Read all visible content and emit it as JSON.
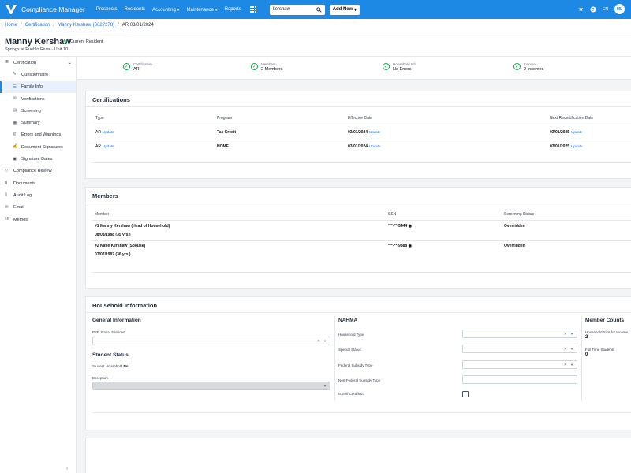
{
  "nav": {
    "brand": "Compliance Manager",
    "items": [
      "Prospects",
      "Residents",
      "Accounting",
      "Maintenance",
      "Reports"
    ],
    "search_value": "kershaw",
    "add_new": "Add New",
    "lang": "EN",
    "user_initials": "ML"
  },
  "breadcrumb": [
    "Home",
    "Certification",
    "Manny Kershaw (6027278)",
    "AR 03/01/2024"
  ],
  "header": {
    "name": "Manny Kershaw",
    "status": "Current Resident",
    "unit": "Springs at Pueblo River - Unit 101"
  },
  "sidebar": {
    "section": "Certification",
    "items": [
      "Questionnaire",
      "Family Info",
      "Verifications",
      "Screening",
      "Summary",
      "Errors and Warnings",
      "Document Signatures",
      "Signature Dates"
    ],
    "top_items": [
      "Compliance Review",
      "Documents",
      "Audit Log",
      "Email",
      "Memos"
    ]
  },
  "status": [
    {
      "label": "Certification",
      "value": "AR"
    },
    {
      "label": "Members",
      "value": "2 Members"
    },
    {
      "label": "Household Info",
      "value": "No Errors"
    },
    {
      "label": "Income",
      "value": "2 Incomes"
    }
  ],
  "certifications": {
    "title": "Certifications",
    "columns": [
      "Type",
      "Program",
      "Effective Date",
      "Next Recertification Date"
    ],
    "update": "Update",
    "rows": [
      {
        "type": "AR",
        "program": "Tax Credit",
        "effective": "03/01/2024",
        "next": "03/01/2025"
      },
      {
        "type": "AR",
        "program": "HOME",
        "effective": "03/01/2024",
        "next": "03/01/2025"
      }
    ]
  },
  "members": {
    "title": "Members",
    "columns": [
      "Member",
      "SSN",
      "Screening Status"
    ],
    "rows": [
      {
        "name": "#1 Manny Kershaw (Head of Household)",
        "dob": "08/08/1988 (35 yrs.)",
        "ssn": "***-**-5444",
        "status": "Overridden"
      },
      {
        "name": "#2 Katie Kershaw (Spouse)",
        "dob": "07/07/1987 (36 yrs.)",
        "ssn": "***-**-9888",
        "status": "Overridden"
      }
    ]
  },
  "household": {
    "title": "Household Information",
    "general_title": "General Information",
    "psr_label": "PSR Social Services",
    "student_title": "Student Status",
    "student_label": "Student Household",
    "student_value": "No",
    "exception_label": "Exception",
    "nahma_title": "NAHMA",
    "nahma_fields": [
      "Household Type",
      "Special Status",
      "Federal Subsidy Type",
      "Non-Federal Subsidy Type",
      "Is Self Certified?"
    ],
    "counts_title": "Member Counts",
    "size_label": "Household Size for Income",
    "size_value": "2",
    "ft_label": "Full Time Students",
    "ft_value": "0"
  },
  "colors": {
    "primary": "#1e88e5",
    "success": "#16a34a",
    "link": "#1e6fd9"
  }
}
